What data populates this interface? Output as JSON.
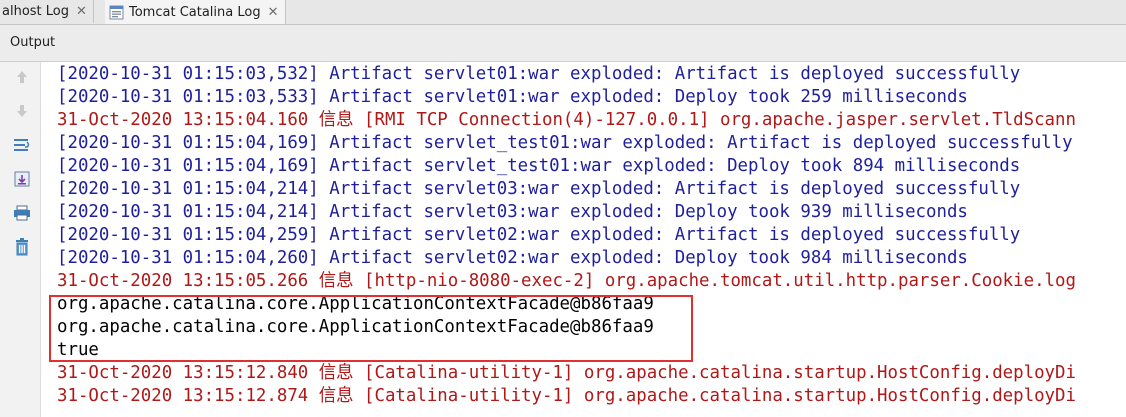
{
  "tabs": [
    {
      "label": "alhost Log",
      "close": "✕"
    },
    {
      "label": "Tomcat Catalina Log",
      "close": "✕"
    }
  ],
  "panel": {
    "title": "Output"
  },
  "colors": {
    "info": "#1f1f9c",
    "error": "#b01818",
    "output": "#000000",
    "highlight": "#e03030"
  },
  "console": {
    "lines": [
      {
        "type": "info",
        "text": "[2020-10-31 01:15:03,532] Artifact servlet01:war exploded: Artifact is deployed successfully"
      },
      {
        "type": "info",
        "text": "[2020-10-31 01:15:03,533] Artifact servlet01:war exploded: Deploy took 259 milliseconds"
      },
      {
        "type": "error",
        "text": "31-Oct-2020 13:15:04.160 信息 [RMI TCP Connection(4)-127.0.0.1] org.apache.jasper.servlet.TldScann"
      },
      {
        "type": "info",
        "text": "[2020-10-31 01:15:04,169] Artifact servlet_test01:war exploded: Artifact is deployed successfully"
      },
      {
        "type": "info",
        "text": "[2020-10-31 01:15:04,169] Artifact servlet_test01:war exploded: Deploy took 894 milliseconds"
      },
      {
        "type": "info",
        "text": "[2020-10-31 01:15:04,214] Artifact servlet03:war exploded: Artifact is deployed successfully"
      },
      {
        "type": "info",
        "text": "[2020-10-31 01:15:04,214] Artifact servlet03:war exploded: Deploy took 939 milliseconds"
      },
      {
        "type": "info",
        "text": "[2020-10-31 01:15:04,259] Artifact servlet02:war exploded: Artifact is deployed successfully"
      },
      {
        "type": "info",
        "text": "[2020-10-31 01:15:04,260] Artifact servlet02:war exploded: Deploy took 984 milliseconds"
      },
      {
        "type": "error",
        "text": "31-Oct-2020 13:15:05.266 信息 [http-nio-8080-exec-2] org.apache.tomcat.util.http.parser.Cookie.log"
      },
      {
        "type": "out",
        "text": "org.apache.catalina.core.ApplicationContextFacade@b86faa9"
      },
      {
        "type": "out",
        "text": "org.apache.catalina.core.ApplicationContextFacade@b86faa9"
      },
      {
        "type": "out",
        "text": "true"
      },
      {
        "type": "error",
        "text": "31-Oct-2020 13:15:12.840 信息 [Catalina-utility-1] org.apache.catalina.startup.HostConfig.deployDi"
      },
      {
        "type": "error",
        "text": "31-Oct-2020 13:15:12.874 信息 [Catalina-utility-1] org.apache.catalina.startup.HostConfig.deployDi"
      }
    ]
  },
  "toolbar": {
    "icons": [
      "scroll-up-icon",
      "scroll-down-icon",
      "soft-wrap-icon",
      "scroll-to-end-icon",
      "print-icon",
      "clear-all-icon"
    ]
  }
}
